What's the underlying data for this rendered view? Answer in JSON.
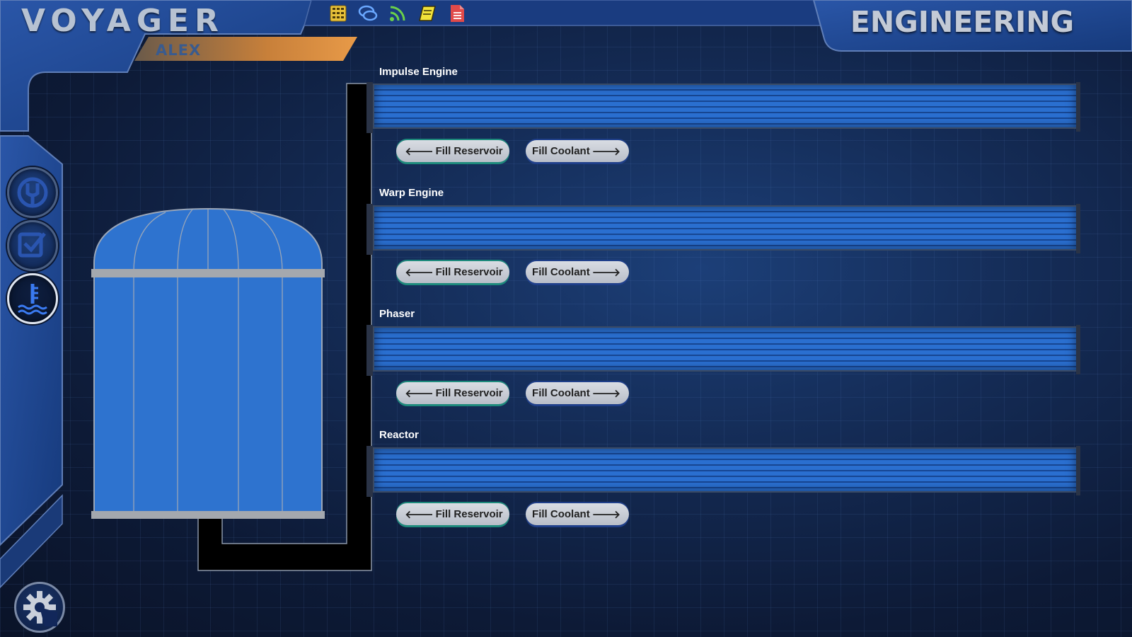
{
  "app": {
    "title": "VOYAGER",
    "user": "ALEX",
    "station": "ENGINEERING"
  },
  "toolbar": {
    "icons": [
      "calculator-icon",
      "chat-icon",
      "rss-icon",
      "notes-icon",
      "document-icon"
    ]
  },
  "nav": {
    "items": [
      "damage-control-icon",
      "checklist-icon",
      "coolant-icon"
    ],
    "active": "coolant-icon",
    "settings": "settings-gear-icon"
  },
  "systems": [
    {
      "name": "Impulse Engine",
      "coolant_level": 1.0,
      "reservoir_label": "Fill Reservoir",
      "coolant_label": "Fill Coolant"
    },
    {
      "name": "Warp Engine",
      "coolant_level": 1.0,
      "reservoir_label": "Fill Reservoir",
      "coolant_label": "Fill Coolant"
    },
    {
      "name": "Phaser",
      "coolant_level": 1.0,
      "reservoir_label": "Fill Reservoir",
      "coolant_label": "Fill Coolant"
    },
    {
      "name": "Reactor",
      "coolant_level": 1.0,
      "reservoir_label": "Fill Reservoir",
      "coolant_label": "Fill Coolant"
    }
  ],
  "reservoir": {
    "level": 1.0
  },
  "colors": {
    "coolant": "#2a6fd0",
    "frame": "#1e3f86",
    "accent": "#d98a3a"
  }
}
